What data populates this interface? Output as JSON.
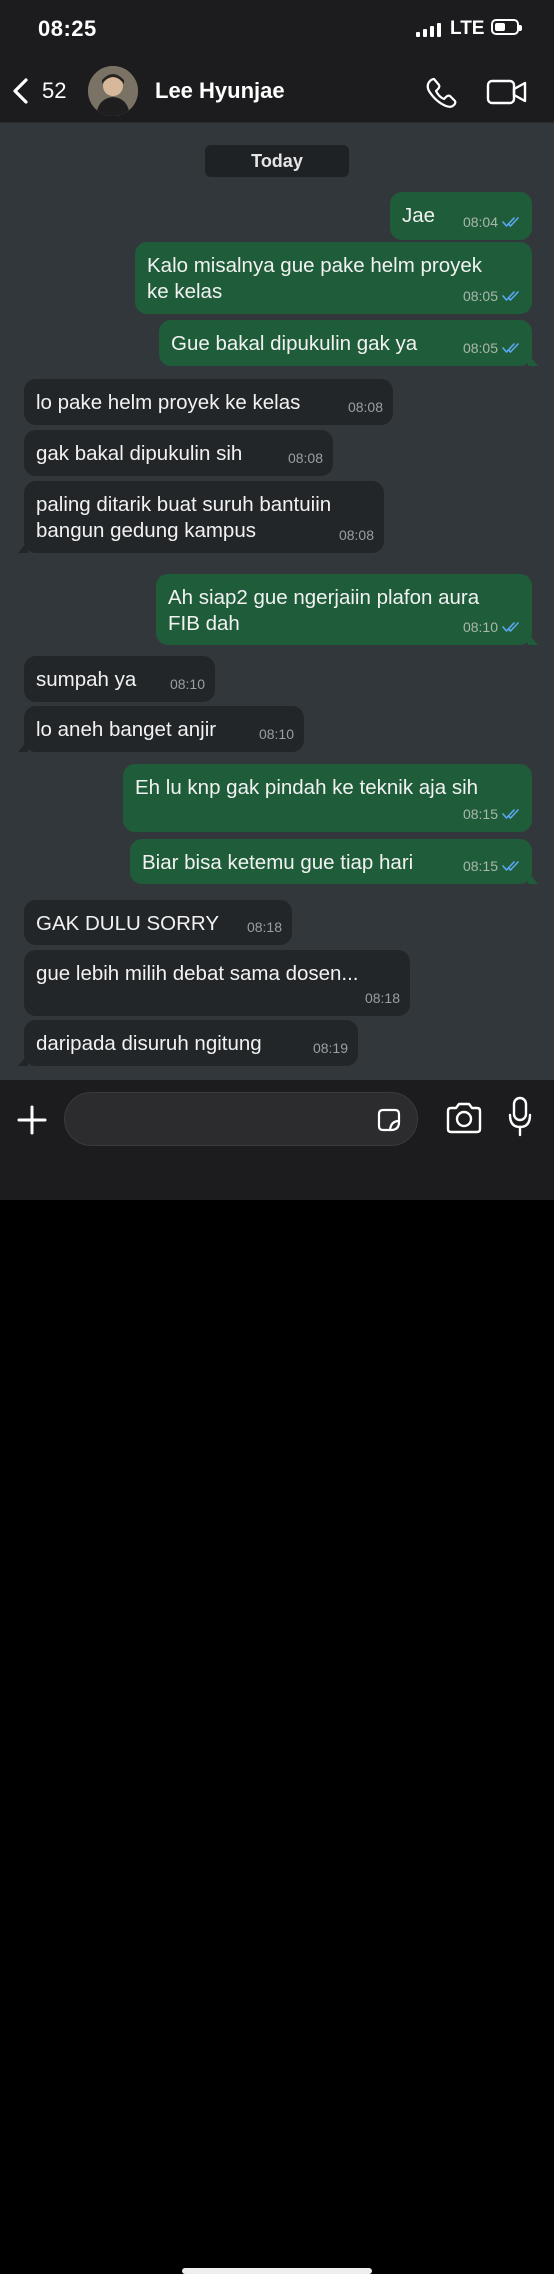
{
  "status": {
    "time": "08:25",
    "network": "LTE"
  },
  "header": {
    "back_count": "52",
    "contact_name": "Lee Hyunjae"
  },
  "chat": {
    "date_label": "Today",
    "messages": [
      {
        "dir": "out",
        "lines": [
          "Jae"
        ],
        "time": "08:04",
        "ticks": true
      },
      {
        "dir": "out",
        "lines": [
          "Kalo misalnya gue pake helm proyek",
          "ke kelas"
        ],
        "time": "08:05",
        "ticks": true
      },
      {
        "dir": "out",
        "lines": [
          "Gue bakal dipukulin gak ya"
        ],
        "time": "08:05",
        "ticks": true
      },
      {
        "dir": "in",
        "lines": [
          "lo pake helm proyek ke kelas"
        ],
        "time": "08:08"
      },
      {
        "dir": "in",
        "lines": [
          "gak bakal dipukulin sih"
        ],
        "time": "08:08"
      },
      {
        "dir": "in",
        "lines": [
          "paling ditarik buat suruh bantuiin",
          "bangun gedung kampus"
        ],
        "time": "08:08"
      },
      {
        "dir": "out",
        "lines": [
          "Ah siap2 gue ngerjaiin plafon aura",
          "FIB dah"
        ],
        "time": "08:10",
        "ticks": true
      },
      {
        "dir": "in",
        "lines": [
          "sumpah ya"
        ],
        "time": "08:10"
      },
      {
        "dir": "in",
        "lines": [
          "lo aneh banget anjir"
        ],
        "time": "08:10"
      },
      {
        "dir": "out",
        "lines": [
          "Eh lu knp gak pindah ke teknik aja sih"
        ],
        "time": "08:15",
        "ticks": true
      },
      {
        "dir": "out",
        "lines": [
          "Biar bisa ketemu gue tiap hari"
        ],
        "time": "08:15",
        "ticks": true
      },
      {
        "dir": "in",
        "lines": [
          "GAK DULU SORRY"
        ],
        "time": "08:18"
      },
      {
        "dir": "in",
        "lines": [
          "gue lebih milih debat sama dosen..."
        ],
        "time": "08:18"
      },
      {
        "dir": "in",
        "lines": [
          "daripada disuruh ngitung"
        ],
        "time": "08:19"
      }
    ]
  },
  "input": {
    "value": ""
  },
  "colors": {
    "outgoing": "#1f5d3a",
    "incoming": "#222628",
    "chat_bg": "#31373a",
    "ticks": "#5aa7f0"
  },
  "icons": [
    "back-chevron-icon",
    "phone-icon",
    "video-camera-icon",
    "plus-icon",
    "sticker-icon",
    "camera-icon",
    "microphone-icon"
  ]
}
